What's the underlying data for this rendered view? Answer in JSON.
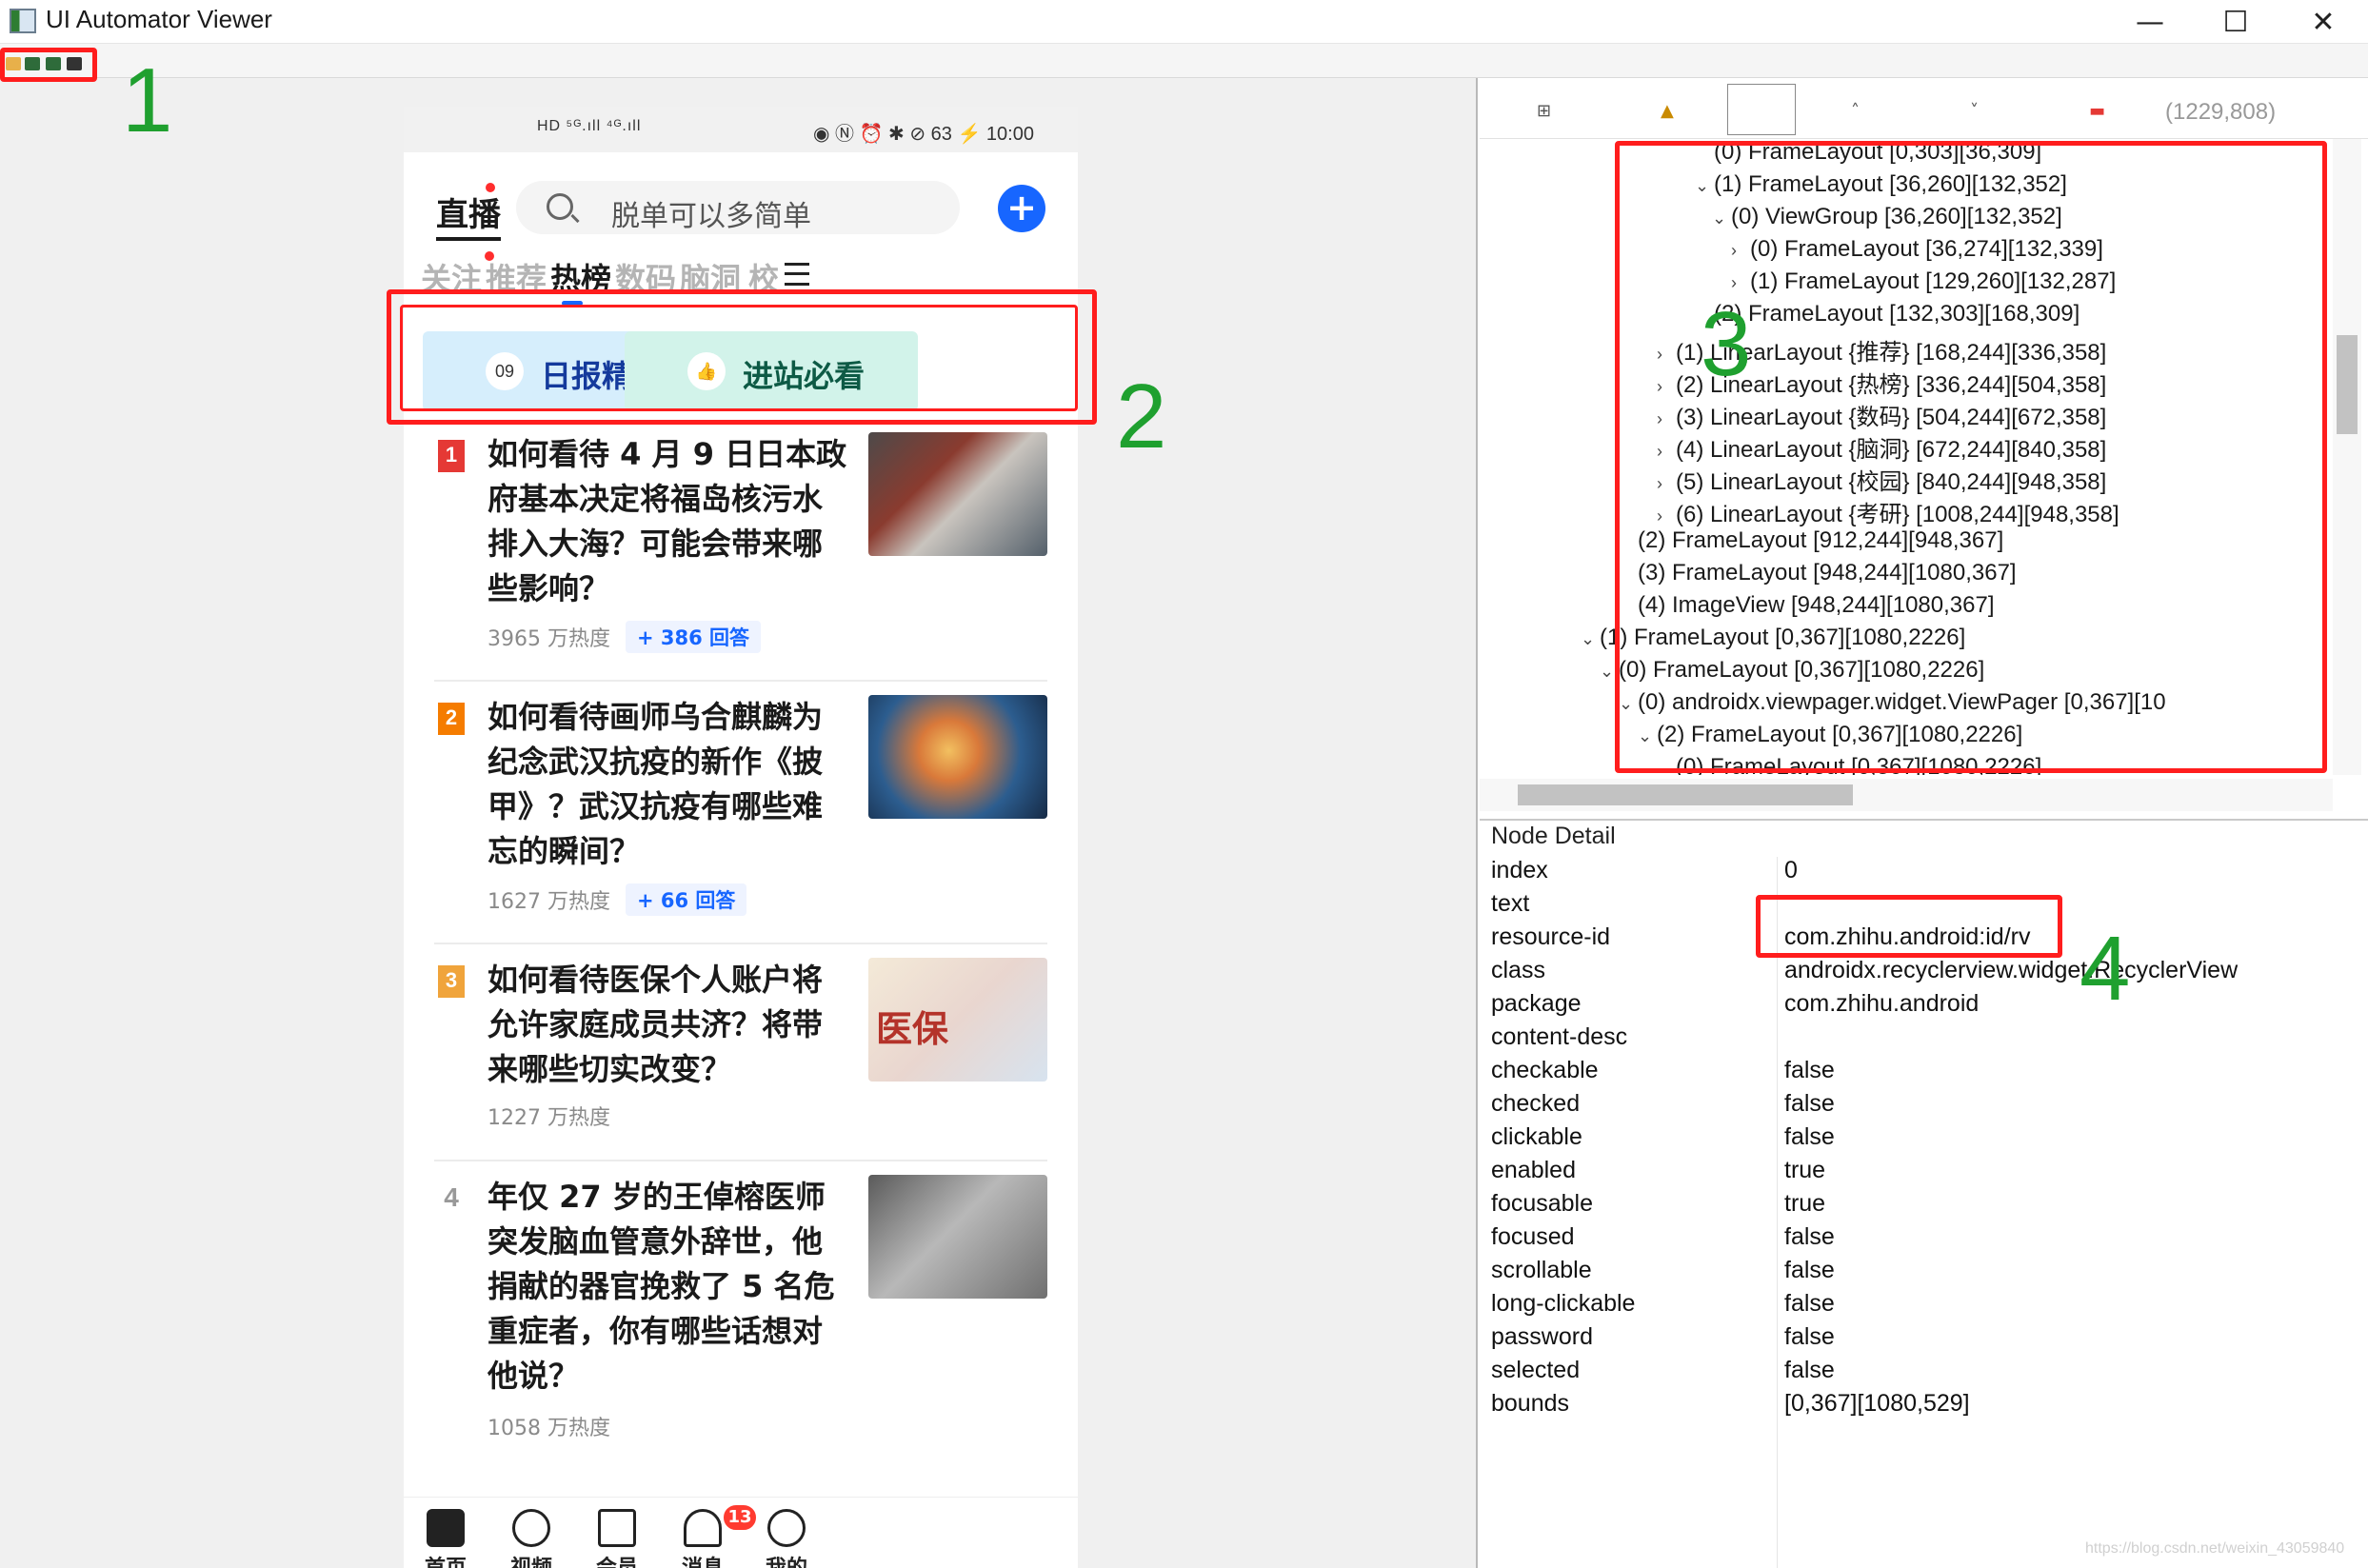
{
  "window": {
    "title": "UI Automator Viewer",
    "controls": [
      "—",
      "☐",
      "✕"
    ]
  },
  "annotations": [
    "1",
    "2",
    "3",
    "4"
  ],
  "phone": {
    "status_left": "HD ⁵ᴳ.ıll ⁴ᴳ.ıll",
    "status_right": "◉ Ⓝ ⏰ ✱ ⊘ 63 ⚡ 10:00",
    "logo": "直播",
    "search_placeholder": "脱单可以多简单",
    "tabs": [
      "关注",
      "推荐",
      "热榜",
      "数码",
      "脑洞",
      "校"
    ],
    "active_tab": "热榜",
    "cards": [
      {
        "badge": "09",
        "label": "日报精选"
      },
      {
        "badge": "👍",
        "label": "进站必看"
      }
    ],
    "feed": [
      {
        "rank": "1",
        "title": "如何看待 4 月 9 日日本政府基本决定将福岛核污水排入大海？可能会带来哪些影响？",
        "heat": "3965 万热度",
        "answers": "+ 386 回答"
      },
      {
        "rank": "2",
        "title": "如何看待画师乌合麒麟为纪念武汉抗疫的新作《披甲》？武汉抗疫有哪些难忘的瞬间？",
        "heat": "1627 万热度",
        "answers": "+ 66 回答"
      },
      {
        "rank": "3",
        "title": "如何看待医保个人账户将允许家庭成员共济？将带来哪些切实改变？",
        "heat": "1227 万热度",
        "answers": "",
        "thumb_text": "医保"
      },
      {
        "rank": "4",
        "title": "年仅 27 岁的王倬榕医师突发脑血管意外辞世，他捐献的器官挽救了 5 名危重症者，你有哪些话想对他说？",
        "heat": "1058 万热度",
        "answers": ""
      }
    ],
    "bottom_nav": [
      "首页",
      "视频",
      "会员",
      "消息",
      "我的"
    ],
    "message_badge": "13"
  },
  "tree": {
    "coords": "(1229,808)",
    "rows": [
      {
        "text": "(0) FrameLayout [0,303][36,309]",
        "toggle": ""
      },
      {
        "text": "(1) FrameLayout [36,260][132,352]",
        "toggle": "⌄"
      },
      {
        "text": "(0) ViewGroup [36,260][132,352]",
        "toggle": "⌄"
      },
      {
        "text": "(0) FrameLayout [36,274][132,339]",
        "toggle": "›"
      },
      {
        "text": "(1) FrameLayout [129,260][132,287]",
        "toggle": "›"
      },
      {
        "text": "(2) FrameLayout [132,303][168,309]",
        "toggle": ""
      },
      {
        "text": "(1) LinearLayout {推荐} [168,244][336,358]",
        "toggle": "›"
      },
      {
        "text": "(2) LinearLayout {热榜} [336,244][504,358]",
        "toggle": "›"
      },
      {
        "text": "(3) LinearLayout {数码} [504,244][672,358]",
        "toggle": "›"
      },
      {
        "text": "(4) LinearLayout {脑洞} [672,244][840,358]",
        "toggle": "›"
      },
      {
        "text": "(5) LinearLayout {校园} [840,244][948,358]",
        "toggle": "›"
      },
      {
        "text": "(6) LinearLayout {考研} [1008,244][948,358]",
        "toggle": "›"
      },
      {
        "text": "(2) FrameLayout [912,244][948,367]",
        "toggle": ""
      },
      {
        "text": "(3) FrameLayout [948,244][1080,367]",
        "toggle": ""
      },
      {
        "text": "(4) ImageView [948,244][1080,367]",
        "toggle": ""
      },
      {
        "text": "(1) FrameLayout [0,367][1080,2226]",
        "toggle": "⌄"
      },
      {
        "text": "(0) FrameLayout [0,367][1080,2226]",
        "toggle": "⌄"
      },
      {
        "text": "(0) androidx.viewpager.widget.ViewPager [0,367][10",
        "toggle": "⌄"
      },
      {
        "text": "(2) FrameLayout [0,367][1080,2226]",
        "toggle": "⌄"
      },
      {
        "text": "(0) FrameLayout [0,367][1080,2226]",
        "toggle": ""
      }
    ]
  },
  "detail": {
    "title": "Node Detail",
    "rows": [
      {
        "key": "index",
        "value": "0"
      },
      {
        "key": "text",
        "value": ""
      },
      {
        "key": "resource-id",
        "value": "com.zhihu.android:id/rv"
      },
      {
        "key": "class",
        "value": "androidx.recyclerview.widget.RecyclerView"
      },
      {
        "key": "package",
        "value": "com.zhihu.android"
      },
      {
        "key": "content-desc",
        "value": ""
      },
      {
        "key": "checkable",
        "value": "false"
      },
      {
        "key": "checked",
        "value": "false"
      },
      {
        "key": "clickable",
        "value": "false"
      },
      {
        "key": "enabled",
        "value": "true"
      },
      {
        "key": "focusable",
        "value": "true"
      },
      {
        "key": "focused",
        "value": "false"
      },
      {
        "key": "scrollable",
        "value": "false"
      },
      {
        "key": "long-clickable",
        "value": "false"
      },
      {
        "key": "password",
        "value": "false"
      },
      {
        "key": "selected",
        "value": "false"
      },
      {
        "key": "bounds",
        "value": "[0,367][1080,529]"
      }
    ]
  },
  "watermark": "https://blog.csdn.net/weixin_43059840",
  "colors": {
    "annotation_red": "#ff1d1d",
    "annotation_green": "#1fa02f",
    "zhihu_blue": "#1766ff",
    "card_blue_bg": "#d6eefc",
    "card_green_bg": "#d2f3ea",
    "rank_1": "#e53935",
    "rank_2": "#f57c00",
    "rank_3": "#f0a43b"
  }
}
